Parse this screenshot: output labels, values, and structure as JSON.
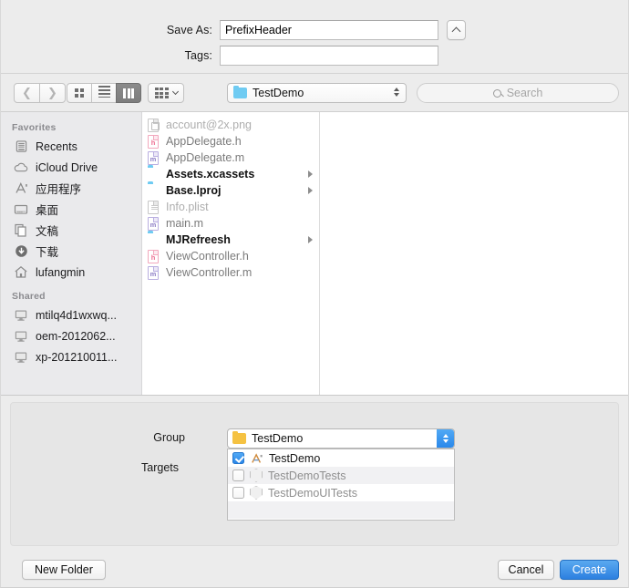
{
  "header": {
    "save_as_label": "Save As:",
    "save_as_value": "PrefixHeader",
    "tags_label": "Tags:",
    "tags_value": "",
    "disclosure_icon": "chevron-up-icon"
  },
  "toolbar": {
    "back_icon": "chevron-left-icon",
    "forward_icon": "chevron-right-icon",
    "view_icon_grid": "icon-view-icon",
    "view_list": "list-view-icon",
    "view_column": "column-view-icon",
    "view_coverflow": "coverflow-view-icon",
    "arrange_caret": "chevron-down-icon",
    "path_label": "TestDemo",
    "path_folder_icon": "folder-icon",
    "search_placeholder": "Search",
    "search_icon": "search-icon"
  },
  "sidebar": {
    "sections": [
      {
        "title": "Favorites",
        "items": [
          {
            "label": "Recents",
            "icon": "recents-icon"
          },
          {
            "label": "iCloud Drive",
            "icon": "cloud-icon"
          },
          {
            "label": "应用程序",
            "icon": "applications-icon"
          },
          {
            "label": "桌面",
            "icon": "desktop-icon"
          },
          {
            "label": "文稿",
            "icon": "documents-icon"
          },
          {
            "label": "下载",
            "icon": "downloads-icon"
          },
          {
            "label": "lufangmin",
            "icon": "home-icon"
          }
        ]
      },
      {
        "title": "Shared",
        "items": [
          {
            "label": "mtilq4d1wxwq...",
            "icon": "computer-icon"
          },
          {
            "label": "oem-2012062...",
            "icon": "computer-icon"
          },
          {
            "label": "xp-201210011...",
            "icon": "computer-icon"
          }
        ]
      }
    ]
  },
  "files": [
    {
      "name": "account@2x.png",
      "icon": "image-file-icon",
      "kind": "image",
      "expandable": false,
      "dim": true
    },
    {
      "name": "AppDelegate.h",
      "icon": "header-file-icon",
      "kind": "h",
      "expandable": false,
      "dim": false
    },
    {
      "name": "AppDelegate.m",
      "icon": "source-file-icon",
      "kind": "m",
      "expandable": false,
      "dim": false
    },
    {
      "name": "Assets.xcassets",
      "icon": "folder-icon",
      "kind": "folder",
      "expandable": true,
      "dim": false
    },
    {
      "name": "Base.lproj",
      "icon": "folder-icon",
      "kind": "folder",
      "expandable": true,
      "dim": false
    },
    {
      "name": "Info.plist",
      "icon": "plist-file-icon",
      "kind": "plist",
      "expandable": false,
      "dim": true
    },
    {
      "name": "main.m",
      "icon": "source-file-icon",
      "kind": "m",
      "expandable": false,
      "dim": false
    },
    {
      "name": "MJRefreesh",
      "icon": "folder-icon",
      "kind": "folder",
      "expandable": true,
      "dim": false
    },
    {
      "name": "ViewController.h",
      "icon": "header-file-icon",
      "kind": "h",
      "expandable": false,
      "dim": false
    },
    {
      "name": "ViewController.m",
      "icon": "source-file-icon",
      "kind": "m",
      "expandable": false,
      "dim": false
    }
  ],
  "accessory": {
    "group_label": "Group",
    "group_value": "TestDemo",
    "group_folder_icon": "folder-icon",
    "group_stepper_icon": "updown-arrows-icon",
    "targets_label": "Targets",
    "targets": [
      {
        "name": "TestDemo",
        "checked": true,
        "icon": "xcode-app-icon"
      },
      {
        "name": "TestDemoTests",
        "checked": false,
        "icon": "test-bundle-icon"
      },
      {
        "name": "TestDemoUITests",
        "checked": false,
        "icon": "test-bundle-icon"
      }
    ]
  },
  "footer": {
    "new_folder_label": "New Folder",
    "cancel_label": "Cancel",
    "create_label": "Create"
  },
  "colors": {
    "accent_blue": "#2d80e0",
    "folder_blue": "#6fcbf2",
    "group_folder_yellow": "#f5c242",
    "window_bg": "#ececec",
    "sidebar_bg": "#eaeaec"
  }
}
